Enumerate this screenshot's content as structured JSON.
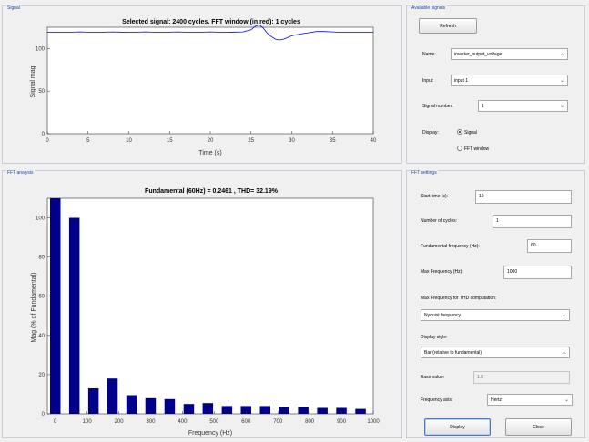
{
  "signal_panel": {
    "title": "Signal",
    "plot_title": "Selected signal: 2400 cycles. FFT window (in red): 1 cycles",
    "ylabel": "Signal mag",
    "xlabel": "Time (s)",
    "y_ticks": [
      "0",
      "50",
      "100"
    ],
    "x_ticks": [
      "0",
      "5",
      "10",
      "15",
      "20",
      "25",
      "30",
      "35",
      "40"
    ]
  },
  "available_signals": {
    "title": "Available signals",
    "refresh_label": "Refresh",
    "name_label": "Name:",
    "name_value": "inverter_output_voltage",
    "input_label": "Input:",
    "input_value": "input 1",
    "signal_number_label": "Signal number:",
    "signal_number_value": "1",
    "display_label": "Display:",
    "signal_option": "Signal",
    "fft_window_option": "FFT window"
  },
  "fft_panel": {
    "title": "FFT analysis",
    "plot_title": "Fundamental (60Hz) = 0.2461 , THD= 32.19%",
    "ylabel": "Mag (% of Fundamental)",
    "xlabel": "Frequency (Hz)",
    "y_ticks": [
      "0",
      "20",
      "40",
      "60",
      "80",
      "100"
    ],
    "x_ticks": [
      "0",
      "100",
      "200",
      "300",
      "400",
      "500",
      "600",
      "700",
      "800",
      "900",
      "1000"
    ]
  },
  "fft_settings": {
    "title": "FFT settings",
    "start_time_label": "Start time (s):",
    "start_time_value": "10",
    "num_cycles_label": "Number of cycles:",
    "num_cycles_value": "1",
    "fund_freq_label": "Fundamental frequency (Hz):",
    "fund_freq_value": "60",
    "max_freq_label": "Max Frequency (Hz):",
    "max_freq_value": "1000",
    "max_freq_thd_label": "Max Frequency for THD computation:",
    "max_freq_thd_value": "Nyquist frequency",
    "display_style_label": "Display style:",
    "display_style_value": "Bar (relative to fundamental)",
    "base_value_label": "Base value:",
    "base_value_value": "1.0",
    "freq_axis_label": "Frequency axis:",
    "freq_axis_value": "Hertz",
    "display_button": "Display",
    "close_button": "Close"
  },
  "chart_data": [
    {
      "type": "line",
      "title": "Selected signal: 2400 cycles. FFT window (in red): 1 cycles",
      "xlabel": "Time (s)",
      "ylabel": "Signal mag",
      "xlim": [
        0,
        40
      ],
      "ylim": [
        0,
        125
      ],
      "series": [
        {
          "color": "#0000ff",
          "x": [
            0,
            2,
            4,
            6,
            8,
            10,
            12,
            14,
            16,
            18,
            20,
            22,
            24,
            25,
            25.5,
            26,
            26.5,
            27,
            27.5,
            28,
            28.5,
            29,
            29.5,
            30,
            31,
            32,
            33,
            34,
            35,
            36,
            38,
            40
          ],
          "y": [
            119,
            119,
            119.5,
            119,
            119.5,
            119,
            119.5,
            119,
            119.5,
            119,
            119.5,
            119,
            119.5,
            122,
            126,
            128,
            124,
            118,
            114,
            111,
            110,
            111,
            113,
            115,
            117,
            118.5,
            120,
            120,
            119.5,
            119,
            119,
            119
          ]
        }
      ]
    },
    {
      "type": "bar",
      "title": "Fundamental (60Hz) = 0.2461 , THD= 32.19%",
      "xlabel": "Frequency (Hz)",
      "ylabel": "Mag (% of Fundamental)",
      "xlim": [
        -25,
        1000
      ],
      "ylim": [
        0,
        110
      ],
      "color": "#00008b",
      "x": [
        0,
        60,
        120,
        180,
        240,
        300,
        360,
        420,
        480,
        540,
        600,
        660,
        720,
        780,
        840,
        900,
        960
      ],
      "values": [
        110,
        100,
        13,
        18,
        9.5,
        8,
        7.5,
        5,
        5.5,
        4,
        4,
        4,
        3.5,
        3.5,
        3,
        3,
        2.5
      ]
    }
  ]
}
